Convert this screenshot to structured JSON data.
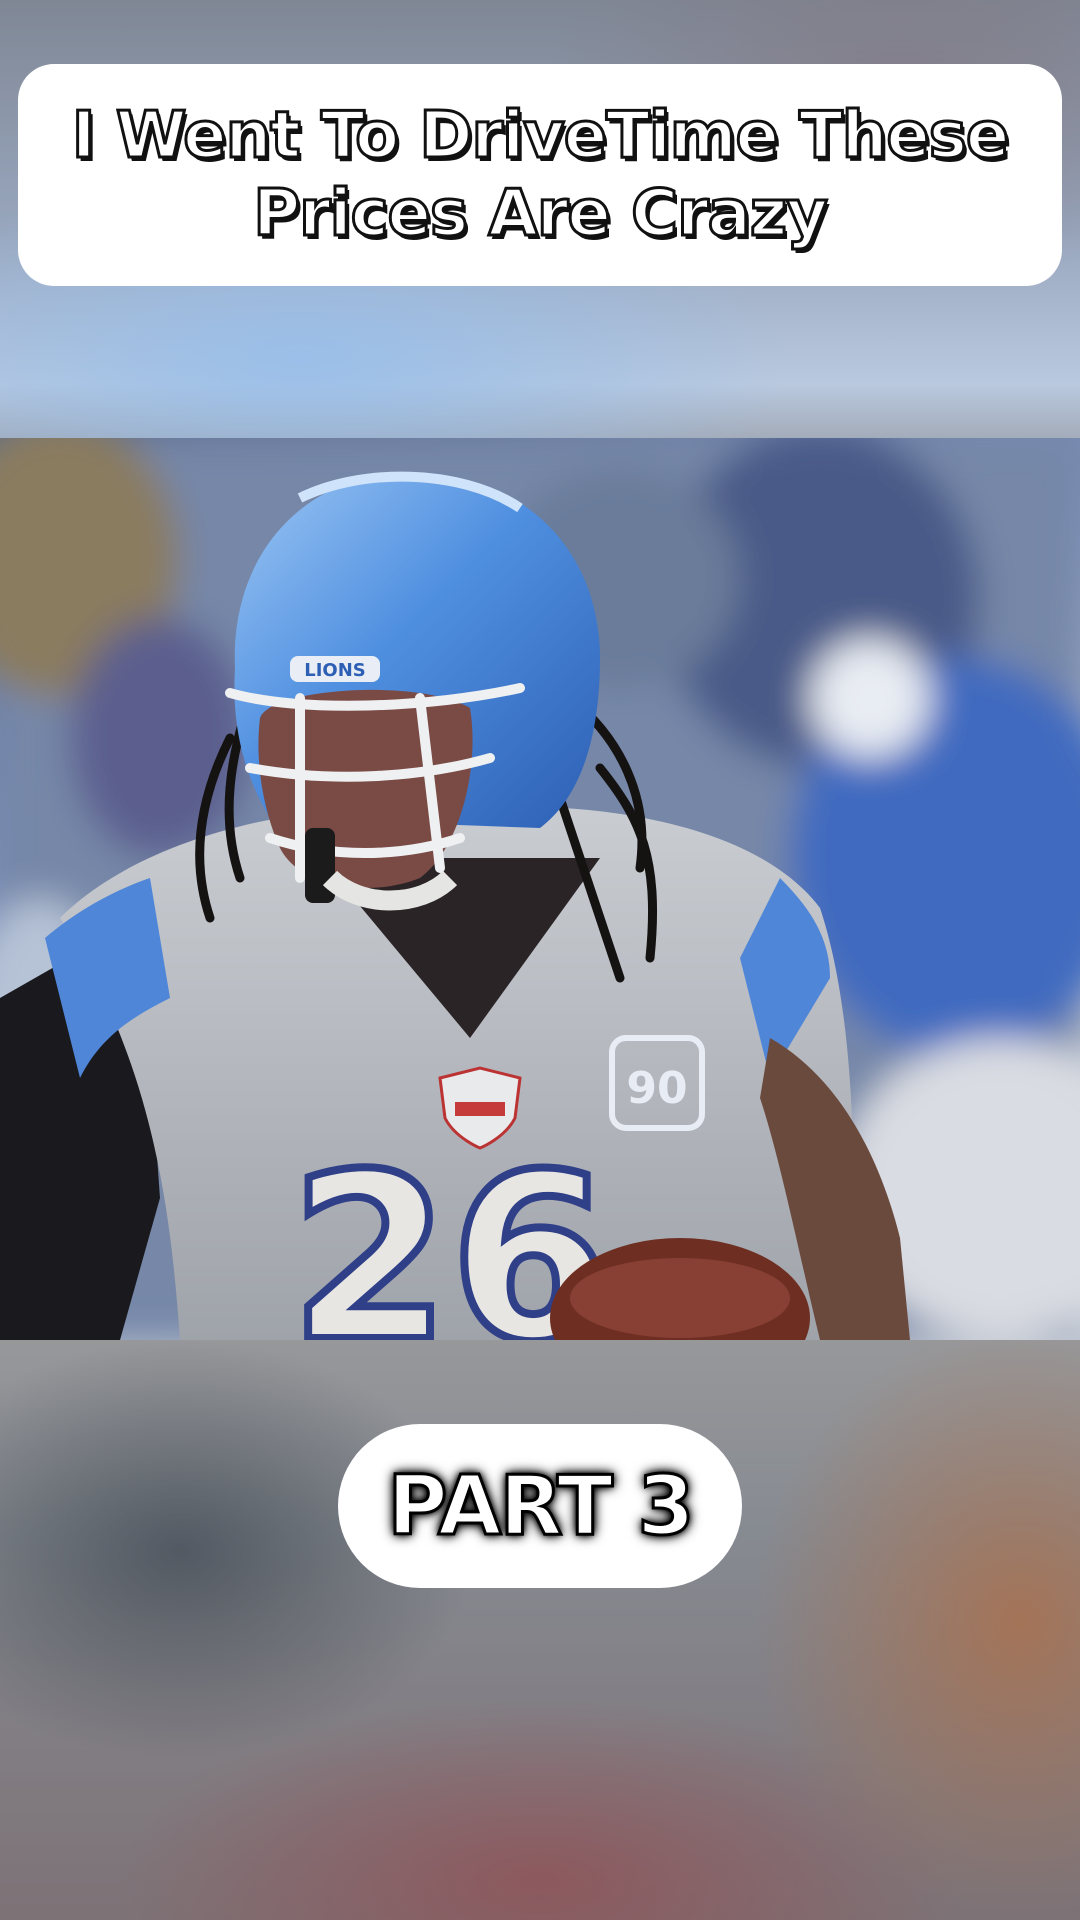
{
  "title": "I Went To DriveTime These Prices Are Crazy",
  "part_label": "PART 3",
  "photo": {
    "subject": "football-player-photo",
    "helmet_text": "LIONS",
    "jersey_number": "26",
    "badge_text": "90"
  },
  "colors": {
    "card_background": "#ffffff",
    "text_fill": "#ffffff",
    "text_outline": "#111111",
    "helmet_blue": "#4f8fe0",
    "jersey_gray": "#b8bcc2"
  }
}
